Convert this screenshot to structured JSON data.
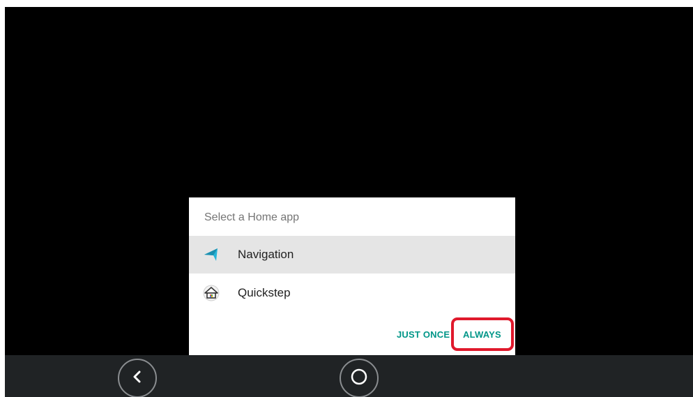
{
  "dialog": {
    "title": "Select a Home app",
    "items": [
      {
        "label": "Navigation",
        "icon": "navigation-arrow-icon",
        "selected": true
      },
      {
        "label": "Quickstep",
        "icon": "house-icon",
        "selected": false
      }
    ],
    "buttons": {
      "just_once": "JUST ONCE",
      "always": "ALWAYS"
    }
  },
  "navbar": {
    "back_icon": "back-chevron-icon",
    "home_icon": "home-circle-icon"
  },
  "colors": {
    "accent": "#009688",
    "highlight": "#e0192c",
    "selected_row": "#e5e5e5",
    "navbar": "#202325",
    "navigation_icon": "#26b5d9"
  }
}
